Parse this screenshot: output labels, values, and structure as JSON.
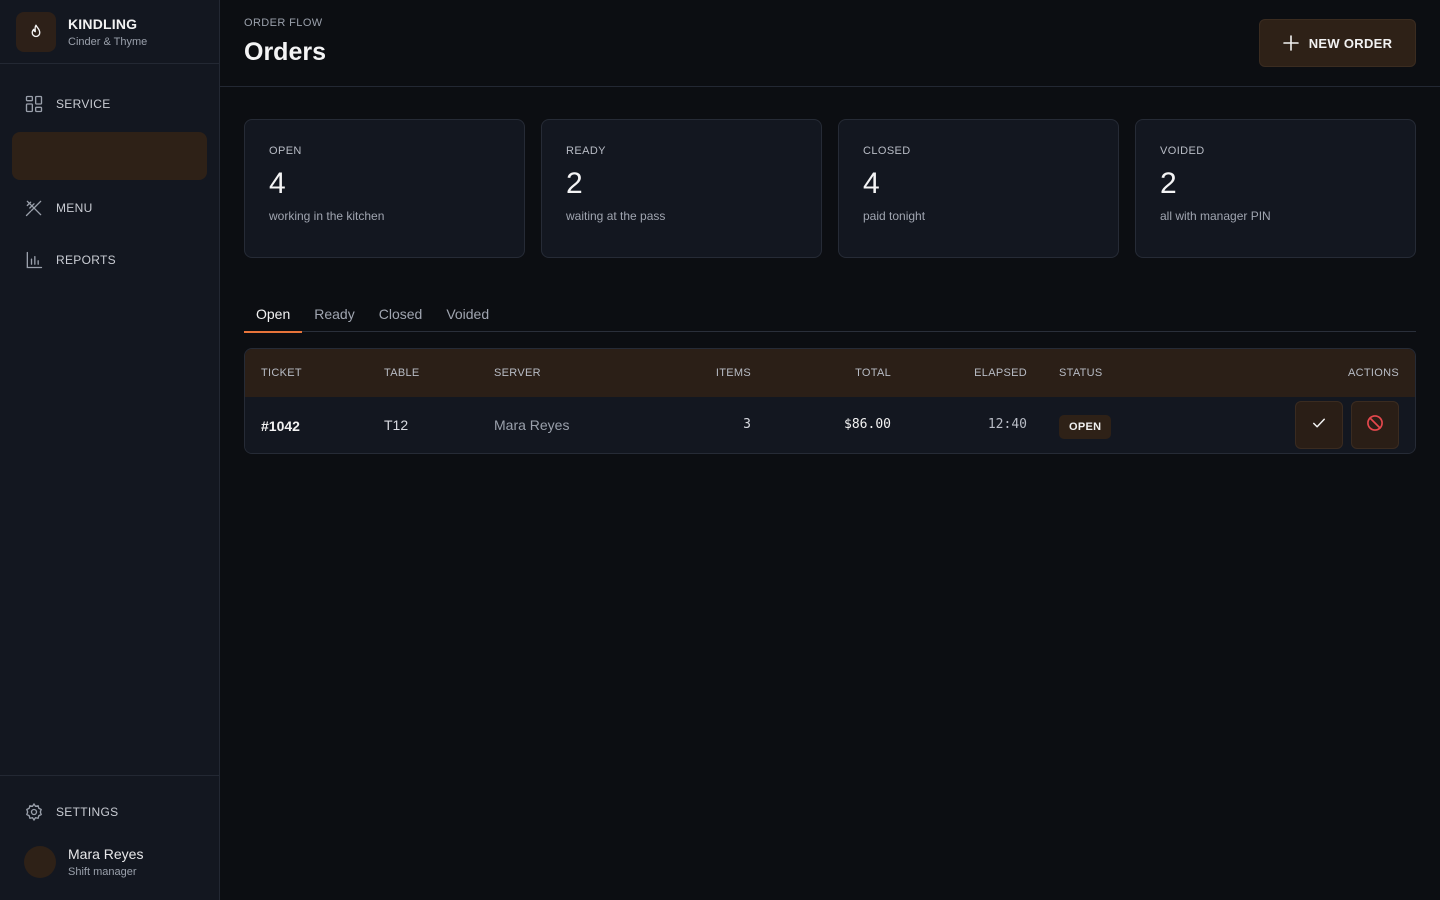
{
  "brand": {
    "name": "KINDLING",
    "subtitle": "Cinder & Thyme",
    "logo_icon": "flame-icon"
  },
  "sidebar": {
    "items": [
      {
        "label": "SERVICE",
        "icon": "grid-icon"
      },
      {
        "label": "",
        "icon": "",
        "active": true
      },
      {
        "label": "MENU",
        "icon": "utensils-icon"
      },
      {
        "label": "REPORTS",
        "icon": "bar-chart-icon"
      }
    ],
    "settings_label": "SETTINGS",
    "user": {
      "name": "Mara Reyes",
      "role": "Shift manager"
    }
  },
  "header": {
    "eyebrow": "ORDER FLOW",
    "title": "Orders",
    "new_order_label": "NEW ORDER"
  },
  "stats": [
    {
      "label": "OPEN",
      "value": "4",
      "desc": "working in the kitchen"
    },
    {
      "label": "READY",
      "value": "2",
      "desc": "waiting at the pass"
    },
    {
      "label": "CLOSED",
      "value": "4",
      "desc": "paid tonight"
    },
    {
      "label": "VOIDED",
      "value": "2",
      "desc": "all with manager PIN"
    }
  ],
  "tabs": [
    "Open",
    "Ready",
    "Closed",
    "Voided"
  ],
  "table": {
    "columns": [
      "TICKET",
      "TABLE",
      "SERVER",
      "ITEMS",
      "TOTAL",
      "ELAPSED",
      "STATUS",
      "ACTIONS"
    ],
    "rows": [
      {
        "ticket": "#1042",
        "table": "T12",
        "server": "Mara Reyes",
        "items": "3",
        "total": "$86.00",
        "elapsed": "12:40",
        "status": "OPEN"
      }
    ]
  },
  "colors": {
    "accent": "#e8743a",
    "brand_surface": "#2e2117",
    "void_red": "#e5484d"
  }
}
